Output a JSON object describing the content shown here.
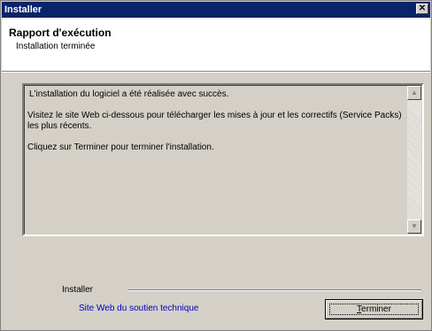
{
  "window": {
    "title": "Installer",
    "close_glyph": "✕"
  },
  "header": {
    "title": "Rapport d'exécution",
    "subtitle": "Installation terminée"
  },
  "report": {
    "lines": [
      "L'installation du logiciel a été réalisée avec succès.",
      "Visitez le site Web ci-dessous pour télécharger les mises à jour et les correctifs (Service Packs) les plus récents.",
      "Cliquez sur Terminer pour terminer l'installation."
    ],
    "scroll_up_glyph": "▲",
    "scroll_down_glyph": "▼"
  },
  "footer": {
    "group_label": "Installer",
    "support_link": "Site Web du soutien technique",
    "finish_mnemonic": "T",
    "finish_rest": "erminer"
  }
}
